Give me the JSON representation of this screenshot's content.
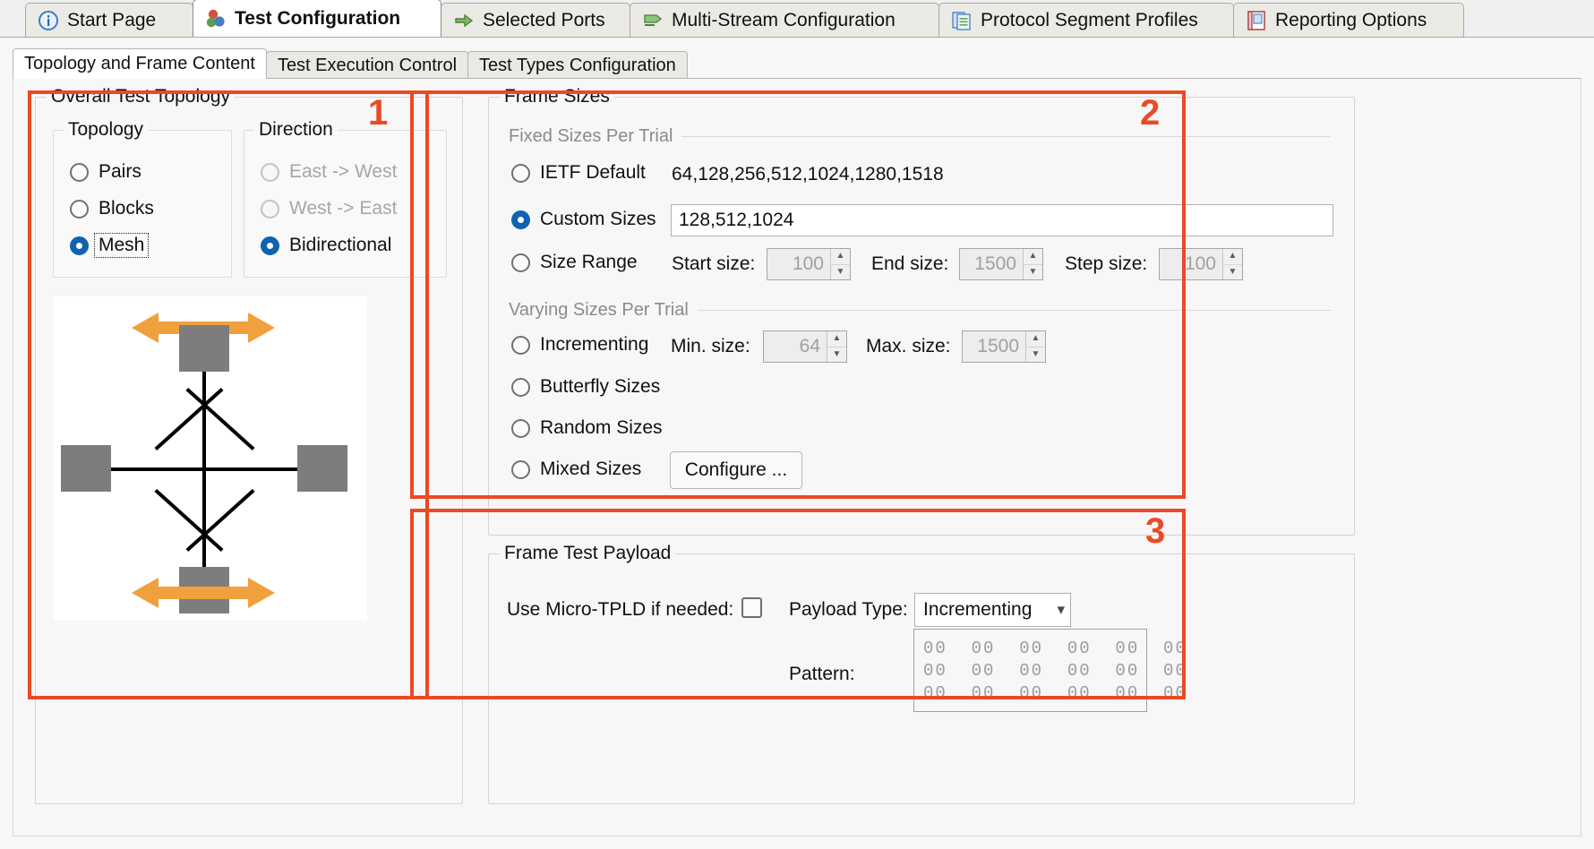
{
  "main_tabs": [
    {
      "label": "Start Page",
      "icon": "info-icon",
      "active": false
    },
    {
      "label": "Test Configuration",
      "icon": "test-config-icon",
      "active": true
    },
    {
      "label": "Selected Ports",
      "icon": "ports-icon",
      "active": false
    },
    {
      "label": "Multi-Stream Configuration",
      "icon": "stream-icon",
      "active": false
    },
    {
      "label": "Protocol Segment Profiles",
      "icon": "profiles-icon",
      "active": false
    },
    {
      "label": "Reporting Options",
      "icon": "report-icon",
      "active": false
    }
  ],
  "sub_tabs": [
    {
      "label": "Topology and Frame Content",
      "active": true
    },
    {
      "label": "Test Execution Control",
      "active": false
    },
    {
      "label": "Test Types Configuration",
      "active": false
    }
  ],
  "annotations": [
    {
      "number": "1"
    },
    {
      "number": "2"
    },
    {
      "number": "3"
    }
  ],
  "topology_panel": {
    "title": "Overall Test Topology",
    "topology_group": {
      "title": "Topology",
      "options": [
        {
          "label": "Pairs",
          "checked": false,
          "disabled": false,
          "focused": false
        },
        {
          "label": "Blocks",
          "checked": false,
          "disabled": false,
          "focused": false
        },
        {
          "label": "Mesh",
          "checked": true,
          "disabled": false,
          "focused": true
        }
      ]
    },
    "direction_group": {
      "title": "Direction",
      "options": [
        {
          "label": "East -> West",
          "checked": false,
          "disabled": true,
          "focused": false
        },
        {
          "label": "West -> East",
          "checked": false,
          "disabled": true,
          "focused": false
        },
        {
          "label": "Bidirectional",
          "checked": true,
          "disabled": false,
          "focused": false
        }
      ]
    },
    "diagram": {
      "kind": "mesh-topology-diagram",
      "node_color": "#7d7d7d",
      "arrow_color": "#f0a03c",
      "node_count": 4,
      "arrow_count": 2
    }
  },
  "frame_sizes": {
    "title": "Frame Sizes",
    "fixed_section_label": "Fixed Sizes Per Trial",
    "varying_section_label": "Varying Sizes Per Trial",
    "ietf": {
      "label": "IETF Default",
      "checked": false,
      "value": "64,128,256,512,1024,1280,1518"
    },
    "custom": {
      "label": "Custom Sizes",
      "checked": true,
      "value": "128,512,1024"
    },
    "size_range": {
      "label": "Size Range",
      "checked": false,
      "start_label": "Start size:",
      "start_value": "100",
      "end_label": "End size:",
      "end_value": "1500",
      "step_label": "Step size:",
      "step_value": "100",
      "disabled": true
    },
    "incrementing": {
      "label": "Incrementing",
      "checked": false,
      "min_label": "Min. size:",
      "min_value": "64",
      "max_label": "Max. size:",
      "max_value": "1500",
      "disabled": true
    },
    "butterfly": {
      "label": "Butterfly Sizes",
      "checked": false
    },
    "random": {
      "label": "Random Sizes",
      "checked": false
    },
    "mixed": {
      "label": "Mixed Sizes",
      "checked": false,
      "button_label": "Configure ..."
    }
  },
  "frame_payload": {
    "title": "Frame Test Payload",
    "micro_tpld_label": "Use Micro-TPLD if needed:",
    "micro_tpld_checked": false,
    "payload_type_label": "Payload Type:",
    "payload_type_value": "Incrementing",
    "pattern_label": "Pattern:",
    "pattern_rows": [
      "00  00  00  00  00  00",
      "00  00  00  00  00  00",
      "00  00  00  00  00  00"
    ]
  },
  "colors": {
    "annotation": "#ea4a26",
    "accent_radio": "#1063b0",
    "arrow": "#f0a03c",
    "node": "#7d7d7d"
  }
}
